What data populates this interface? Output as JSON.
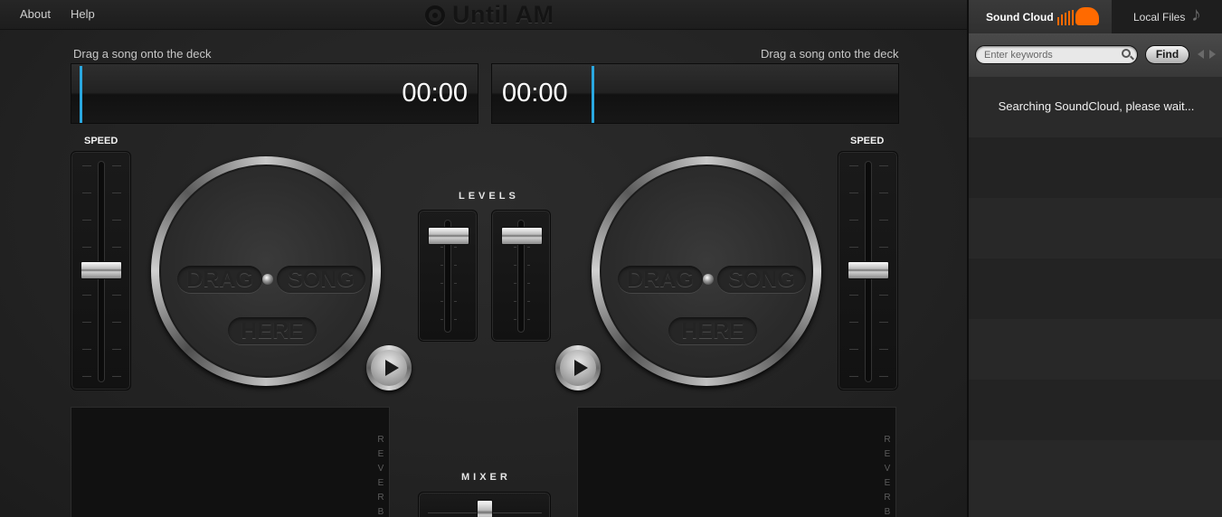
{
  "menu": {
    "about": "About",
    "help": "Help"
  },
  "logo": {
    "text": "Until AM",
    "icon": "vinyl-record-icon"
  },
  "deck_left": {
    "hint": "Drag a song onto the deck",
    "time": "00:00",
    "speed_label": "SPEED",
    "platter": [
      "DRAG",
      "SONG",
      "HERE"
    ]
  },
  "deck_right": {
    "hint": "Drag a song onto the deck",
    "time": "00:00",
    "speed_label": "SPEED",
    "platter": [
      "DRAG",
      "SONG",
      "HERE"
    ]
  },
  "levels_label": "LEVELS",
  "mixer_label": "MIXER",
  "fx": {
    "letters": [
      "R",
      "E",
      "V",
      "E",
      "R",
      "B"
    ]
  },
  "colors": {
    "accent": "#2aa8e0",
    "soundcloud": "#ff6a00"
  },
  "panel": {
    "tab_soundcloud": "Sound Cloud",
    "tab_local": "Local Files",
    "search": {
      "placeholder": "Enter keywords",
      "value": ""
    },
    "find_label": "Find",
    "status": "Searching SoundCloud, please wait..."
  }
}
